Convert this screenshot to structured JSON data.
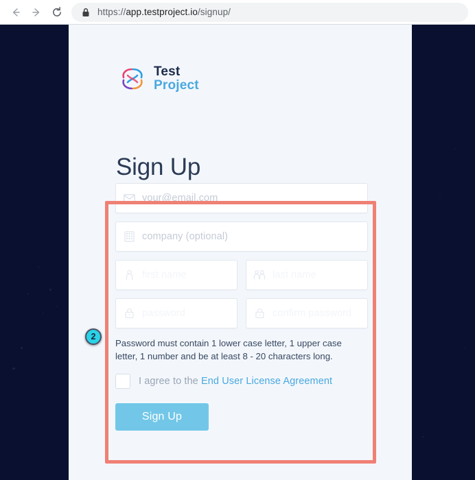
{
  "browser": {
    "back_icon": "back-arrow-icon",
    "forward_icon": "forward-arrow-icon",
    "reload_icon": "reload-icon",
    "lock_icon": "lock-icon",
    "url_scheme": "https://",
    "url_host": "app.testproject.io",
    "url_path": "/signup/"
  },
  "brand": {
    "logo_icon": "testproject-logo-icon",
    "name_line1": "Test",
    "name_line2": "Project",
    "color_dark": "#1c2b4b",
    "color_blue": "#4aa8e0"
  },
  "page": {
    "heading": "Sign Up",
    "background_color": "#0a1130",
    "card_color": "#f3f7fc"
  },
  "form": {
    "fields": [
      {
        "name": "email",
        "icon": "envelope-icon",
        "placeholder": "your@email.com",
        "value": "",
        "faint": false
      },
      {
        "name": "company",
        "icon": "building-icon",
        "placeholder": "company (optional)",
        "value": "",
        "faint": false
      },
      {
        "name": "first-name",
        "icon": "person-icon",
        "placeholder": "first name",
        "value": "",
        "faint": true
      },
      {
        "name": "last-name",
        "icon": "people-icon",
        "placeholder": "last name",
        "value": "",
        "faint": true
      },
      {
        "name": "password",
        "icon": "lock-icon",
        "placeholder": "password",
        "value": "",
        "faint": true
      },
      {
        "name": "confirm-password",
        "icon": "lock-icon",
        "placeholder": "confirm password",
        "value": "",
        "faint": true
      }
    ],
    "password_hint": "Password must contain 1 lower case letter, 1 upper case letter, 1 number and be at least 8 - 20 characters long.",
    "agree_prefix": "I agree to the ",
    "eula_link": "End User License Agreement",
    "checkbox_checked": false,
    "submit_label": "Sign Up",
    "submit_color": "#72c7e8"
  },
  "annotation": {
    "badge_number": "2",
    "badge_color": "#2ad2e8",
    "box_color": "#ef8074"
  }
}
